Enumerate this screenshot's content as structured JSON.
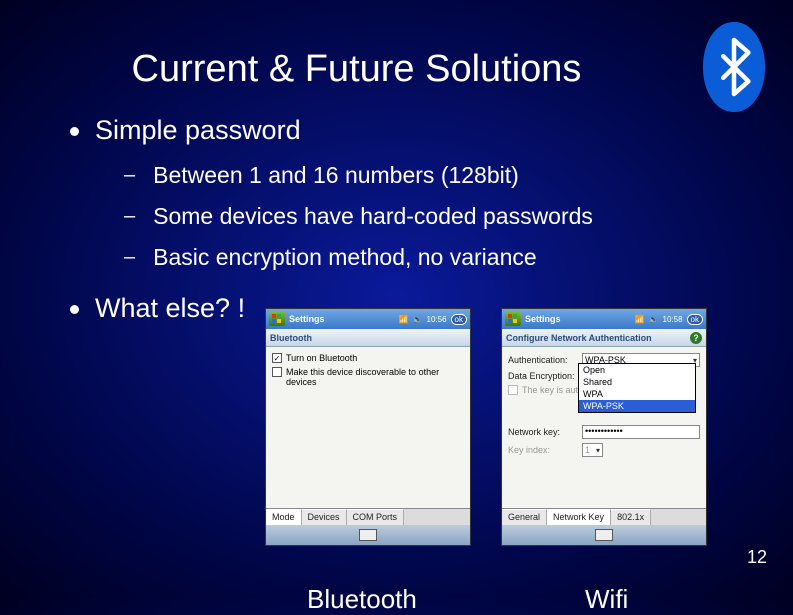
{
  "title": "Current & Future Solutions",
  "bullets": {
    "l1a": "Simple password",
    "l2a": "Between 1 and 16 numbers (128bit)",
    "l2b": "Some devices have hard-coded passwords",
    "l2c": "Basic encryption method, no variance",
    "l1b": "What else? !"
  },
  "shot_bt": {
    "title": "Settings",
    "signal": "📶",
    "sound": "🔈",
    "time": "10:56",
    "ok": "ok",
    "subtitle": "Bluetooth",
    "chk1": "Turn on Bluetooth",
    "chk2": "Make this device discoverable to other devices",
    "tabs": [
      "Mode",
      "Devices",
      "COM Ports"
    ]
  },
  "shot_wf": {
    "title": "Settings",
    "signal": "📶",
    "sound": "🔈",
    "time": "10:58",
    "ok": "ok",
    "subtitle": "Configure Network Authentication",
    "rows": {
      "auth_lbl": "Authentication:",
      "auth_val": "WPA-PSK",
      "enc_lbl": "Data Encryption:",
      "autokey": "The key is autom",
      "dd": [
        "Open",
        "Shared",
        "WPA",
        "WPA-PSK"
      ],
      "netkey_lbl": "Network key:",
      "netkey_val": "••••••••••••",
      "idx_lbl": "Key index:",
      "idx_val": "1"
    },
    "tabs": [
      "General",
      "Network Key",
      "802.1x"
    ]
  },
  "captions": {
    "bt": "Bluetooth",
    "wf": "Wifi"
  },
  "page": "12"
}
